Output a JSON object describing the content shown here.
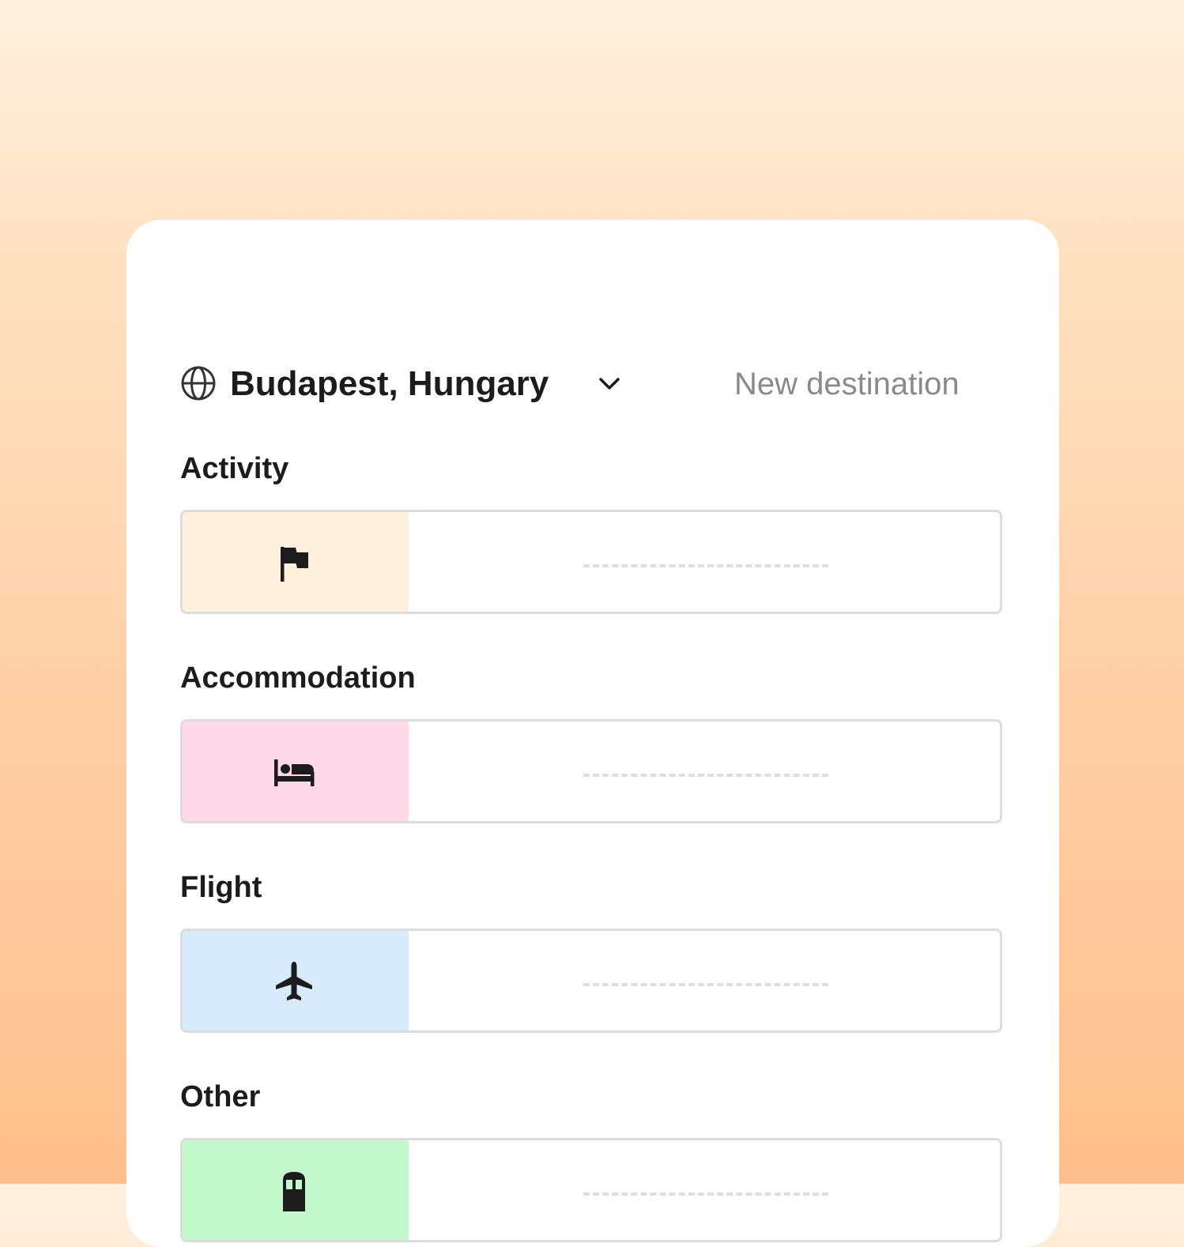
{
  "destination": {
    "name": "Budapest, Hungary",
    "new_label": "New destination",
    "icon": "globe-icon",
    "dropdown_icon": "chevron-down-icon"
  },
  "sections": [
    {
      "label": "Activity",
      "icon": "flag-icon",
      "color": "#ffefdd"
    },
    {
      "label": "Accommodation",
      "icon": "bed-icon",
      "color": "#ffd9e8"
    },
    {
      "label": "Flight",
      "icon": "airplane-icon",
      "color": "#d8ebfd"
    },
    {
      "label": "Other",
      "icon": "train-icon",
      "color": "#c2f8cb"
    }
  ]
}
